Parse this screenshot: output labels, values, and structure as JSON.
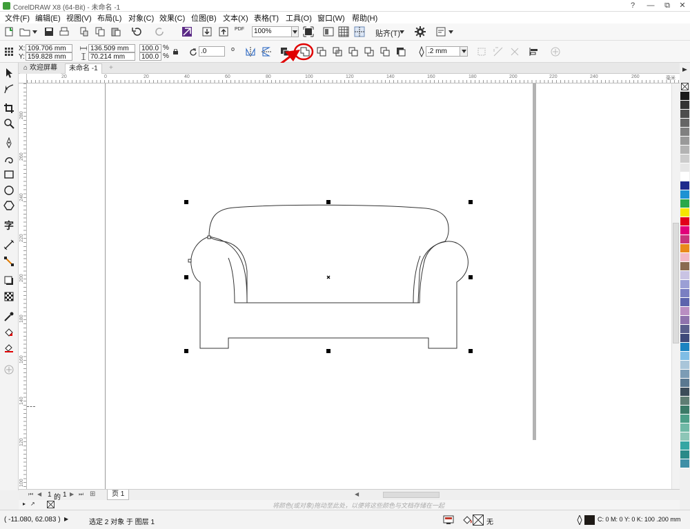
{
  "window": {
    "title": "CorelDRAW X8 (64-Bit) - 未命名 -1",
    "controls": [
      "?",
      "—",
      "⧉",
      "✕"
    ]
  },
  "menu": [
    "文件(F)",
    "编辑(E)",
    "视图(V)",
    "布局(L)",
    "对象(C)",
    "效果(C)",
    "位图(B)",
    "文本(X)",
    "表格(T)",
    "工具(O)",
    "窗口(W)",
    "帮助(H)"
  ],
  "toolbar": {
    "zoom_value": "100%",
    "snap_label": "贴齐(T)",
    "pdf_label": "PDF"
  },
  "property_bar": {
    "x_label": "X:",
    "x_value": "109.706 mm",
    "y_label": "Y:",
    "y_value": "159.828 mm",
    "width_value": "136.509 mm",
    "height_value": "70.214 mm",
    "scale_x": "100.0",
    "scale_y": "100.0",
    "percent": "%",
    "rotation_value": ".0",
    "outline_width": ".2 mm"
  },
  "tabs": {
    "welcome": "欢迎屏幕",
    "document": "未命名 -1",
    "add": "+"
  },
  "rulers": {
    "unit": "毫米",
    "h_ticks": [
      "20",
      "0",
      "20",
      "40",
      "60",
      "80",
      "100",
      "120",
      "140",
      "160",
      "180",
      "200",
      "220",
      "240",
      "260"
    ],
    "v_ticks": [
      "280",
      "260",
      "240",
      "220",
      "200",
      "180",
      "160",
      "140",
      "120",
      "100",
      "80",
      "60"
    ]
  },
  "page_nav": {
    "current": "1",
    "of": "的",
    "total": "1",
    "page_tab": "页 1"
  },
  "hint_text": "将颜色(或对象)拖动至此处，以便将这些颜色与文档存储在一起",
  "status": {
    "cursor": "( -11.080, 62.083 )",
    "selection": "选定 2 对象 于 图层 1",
    "fill_none": "无",
    "outline_info": "C: 0 M: 0 Y: 0 K: 100  .200 mm"
  },
  "colors": {
    "palette": [
      "#1a1a1a",
      "#333333",
      "#4d4d4d",
      "#666666",
      "#808080",
      "#999999",
      "#b3b3b3",
      "#cccccc",
      "#e6e6e6",
      "#ffffff",
      "#1f2a8c",
      "#1d92d3",
      "#27a84a",
      "#f5e600",
      "#e1001a",
      "#e1007a",
      "#c8347d",
      "#e98a1c",
      "#f2b8c6",
      "#8a6b50",
      "#c9c3e3",
      "#9b9fd5",
      "#7a7fc2",
      "#5c63ad",
      "#b98ec2",
      "#8f73ad",
      "#5a5f8c",
      "#3f4a7a",
      "#1b83c1",
      "#7fbde5",
      "#a9c5d9",
      "#7c9cb5",
      "#5a7890",
      "#3c4c59",
      "#5f7d73",
      "#3b7a67",
      "#4b9e87",
      "#6fb9a6",
      "#8dc6b7",
      "#35a6a3",
      "#2a8a88",
      "#3f8fa6"
    ],
    "arrow": "#e00000",
    "select_fill": "#7a1fa2"
  }
}
